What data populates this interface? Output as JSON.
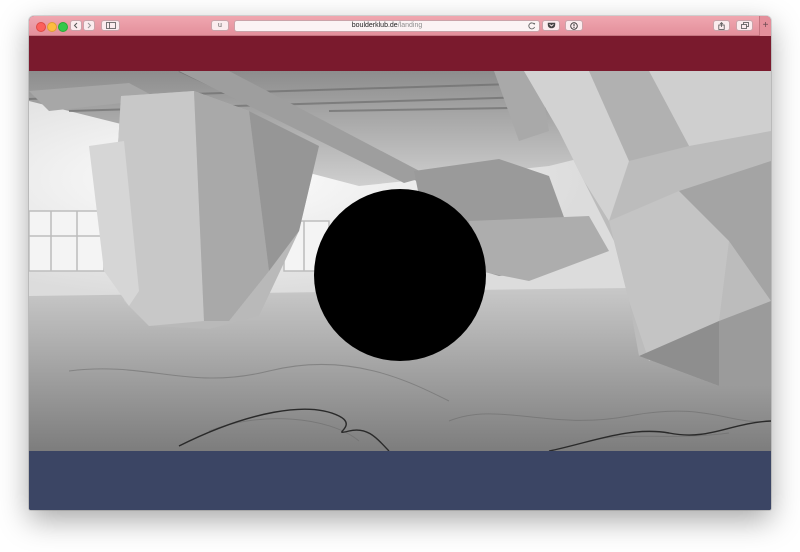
{
  "browser": {
    "reader_button_label": "u",
    "url_domain": "boulderklub.de",
    "url_path": "/landing",
    "new_tab_label": "+"
  },
  "page": {
    "header_color": "#7a1a2d",
    "footer_color": "#3b4564",
    "circle_color": "#000000"
  },
  "icons": [
    "back-icon",
    "forward-icon",
    "sidebar-icon",
    "reload-icon",
    "pocket-icon",
    "extension-icon",
    "share-icon",
    "tabs-icon"
  ]
}
